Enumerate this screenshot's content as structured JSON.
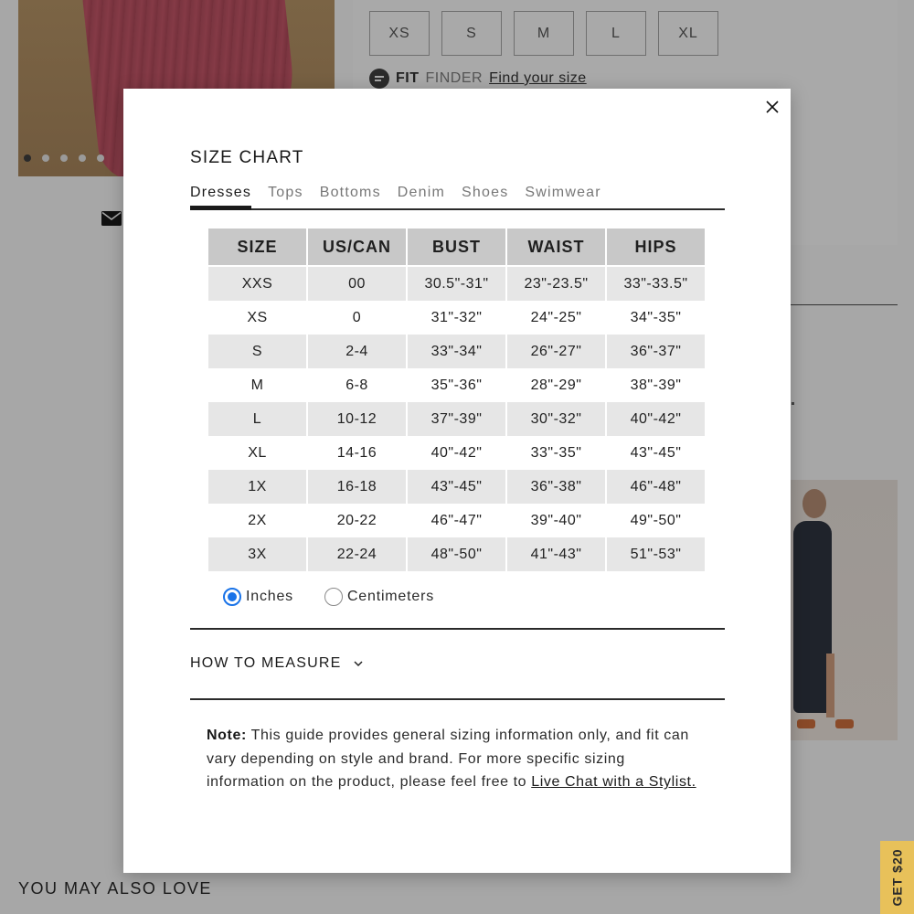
{
  "background": {
    "sizes": [
      "XS",
      "S",
      "M",
      "L",
      "XL"
    ],
    "fit_finder": {
      "bold": "FIT",
      "light": "FINDER",
      "link": "Find your size"
    },
    "also_love": "YOU MAY ALSO LOVE",
    "promo": "GET $20"
  },
  "modal": {
    "title": "SIZE CHART",
    "tabs": [
      "Dresses",
      "Tops",
      "Bottoms",
      "Denim",
      "Shoes",
      "Swimwear"
    ],
    "active_tab": "Dresses",
    "table": {
      "headers": [
        "SIZE",
        "US/CAN",
        "BUST",
        "WAIST",
        "HIPS"
      ],
      "rows": [
        [
          "XXS",
          "00",
          "30.5\"-31\"",
          "23\"-23.5\"",
          "33\"-33.5\""
        ],
        [
          "XS",
          "0",
          "31\"-32\"",
          "24\"-25\"",
          "34\"-35\""
        ],
        [
          "S",
          "2-4",
          "33\"-34\"",
          "26\"-27\"",
          "36\"-37\""
        ],
        [
          "M",
          "6-8",
          "35\"-36\"",
          "28\"-29\"",
          "38\"-39\""
        ],
        [
          "L",
          "10-12",
          "37\"-39\"",
          "30\"-32\"",
          "40\"-42\""
        ],
        [
          "XL",
          "14-16",
          "40\"-42\"",
          "33\"-35\"",
          "43\"-45\""
        ],
        [
          "1X",
          "16-18",
          "43\"-45\"",
          "36\"-38\"",
          "46\"-48\""
        ],
        [
          "2X",
          "20-22",
          "46\"-47\"",
          "39\"-40\"",
          "49\"-50\""
        ],
        [
          "3X",
          "22-24",
          "48\"-50\"",
          "41\"-43\"",
          "51\"-53\""
        ]
      ]
    },
    "units": {
      "inches": "Inches",
      "centimeters": "Centimeters",
      "selected": "Inches"
    },
    "how_to_measure": "HOW TO MEASURE",
    "note": {
      "label": "Note:",
      "text": " This guide provides general sizing information only, and fit can vary depending on style and brand. For more specific sizing information on the product, please feel free to ",
      "link": "Live Chat with a Stylist."
    }
  },
  "colors": {
    "overlay_bg": "#a7a7a7",
    "radio_accent": "#1a73e8",
    "header_cell": "#c8c8c8",
    "shaded_row": "#e6e6e6",
    "promo_tab": "#e8c15a"
  }
}
